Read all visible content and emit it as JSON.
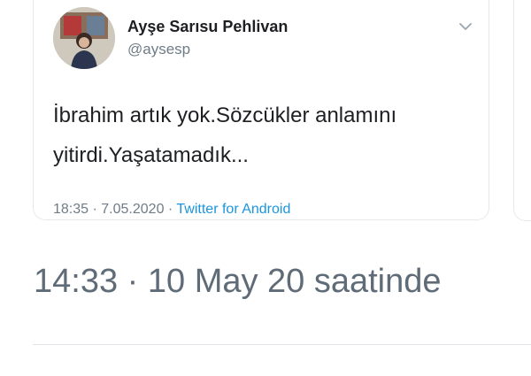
{
  "tweet": {
    "author_name": "Ayşe Sarısu Pehlivan",
    "author_handle": "@aysesp",
    "text_line1": "İbrahim artık yok.Sözcükler anlamını",
    "text_line2": "yitirdi.Yaşatamadık...",
    "time": "18:35",
    "separator1": "·",
    "date": "7.05.2020",
    "separator2": "·",
    "source": "Twitter for Android",
    "avatar_icon": "profile-photo",
    "menu_icon": "chevron-down-icon"
  },
  "share_timestamp": "14:33 · 10 May 20 saatinde",
  "colors": {
    "text_primary": "#1d1f23",
    "text_secondary": "#6f7c87",
    "link": "#1b95e0",
    "border": "#e6e9ec"
  }
}
